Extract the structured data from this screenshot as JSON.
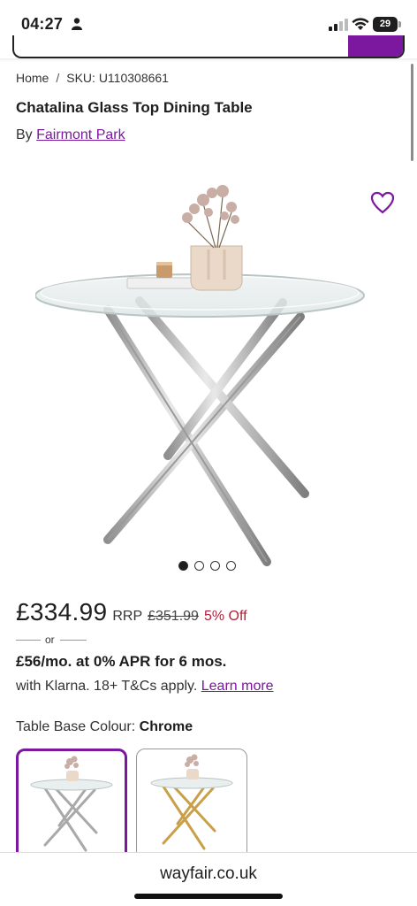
{
  "status_bar": {
    "time": "04:27",
    "battery": "29"
  },
  "breadcrumb": {
    "home": "Home",
    "separator": "/",
    "sku": "SKU: U110308661"
  },
  "product": {
    "title": "Chatalina Glass Top Dining Table",
    "by_label": "By",
    "brand": "Fairmont Park",
    "image_icon": "heart-icon",
    "carousel": {
      "total": 4,
      "active": 1
    }
  },
  "pricing": {
    "price": "£334.99",
    "rrp_label": "RRP",
    "rrp_price": "£351.99",
    "discount": "5% Off",
    "or": "or",
    "finance": "£56/mo. at 0% APR for 6 mos.",
    "klarna_text": "with Klarna. 18+ T&Cs apply.",
    "learn_more": "Learn more"
  },
  "options": {
    "label": "Table Base Colour:",
    "selected": "Chrome",
    "swatches": [
      "chrome",
      "gold"
    ]
  },
  "browser": {
    "url": "wayfair.co.uk"
  },
  "colors": {
    "brand_purple": "#7b189f",
    "discount_red": "#b01f36"
  }
}
